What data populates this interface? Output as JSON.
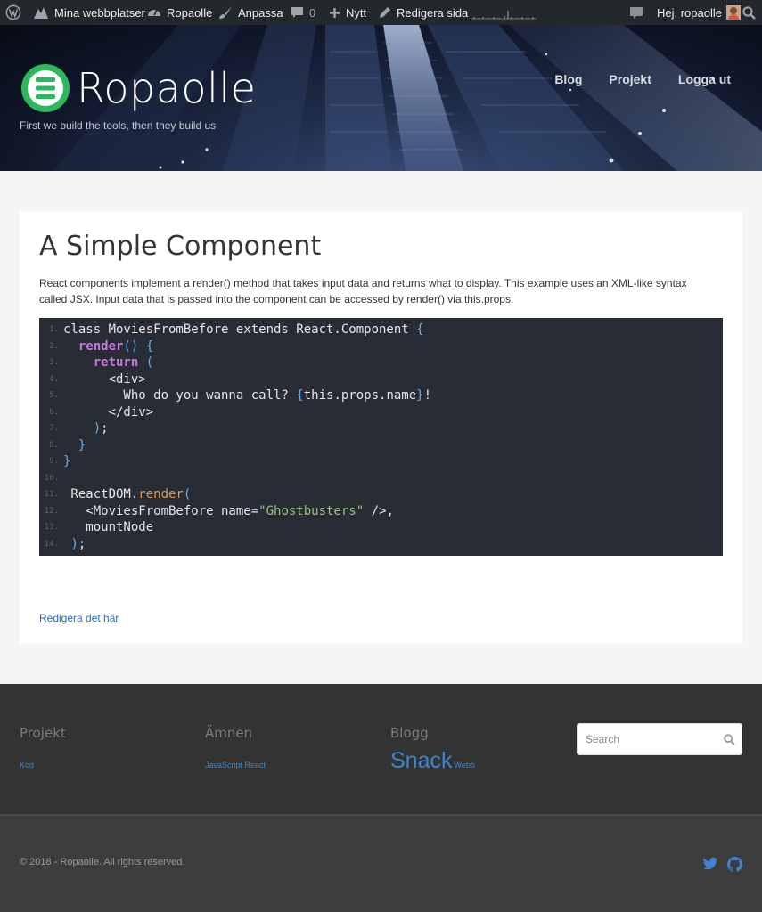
{
  "adminbar": {
    "sites_label": "Mina webbplatser",
    "site_label": "Ropaolle",
    "customize_label": "Anpassa",
    "comments_count": "0",
    "new_label": "Nytt",
    "edit_page_label": "Redigera sida",
    "greeting": "Hej, ropaolle"
  },
  "header": {
    "site_title": "Ropaolle",
    "tagline": "First we build the tools, then they build us",
    "nav": [
      "Blog",
      "Projekt",
      "Logga ut"
    ]
  },
  "post": {
    "title": "A Simple Component",
    "intro": "React components implement a render() method that takes input data and returns what to display. This example uses an XML-like syntax called JSX. Input data that is passed into the component can be accessed by render() via this.props.",
    "code_lines": [
      "class MoviesFromBefore extends React.Component {",
      "  render() {",
      "    return (",
      "      <div>",
      "        Who do you wanna call? {this.props.name}!",
      "      </div>",
      "    );",
      "  }",
      "}",
      "",
      " ReactDOM.render(",
      "   <MoviesFromBefore name=\"Ghostbusters\" />,",
      "   mountNode",
      " );"
    ],
    "edit_link": "Redigera det här"
  },
  "footer": {
    "widgets": [
      {
        "title": "Projekt",
        "links": [
          "Kod"
        ]
      },
      {
        "title": "Ämnen",
        "links": [
          "JavaScript React"
        ]
      },
      {
        "title": "Blogg",
        "tags": [
          "Snack",
          "Webb"
        ]
      }
    ],
    "search_placeholder": "Search",
    "copyright": "© 2018 - Ropaolle. All rights reserved."
  },
  "colors": {
    "admin_bar": "#23282d",
    "accent": "#3d86cf",
    "logo_green": "#2eb85c",
    "code_bg": "#282c34"
  },
  "icons": [
    "wordpress-icon",
    "my-sites-icon",
    "dashboard-icon",
    "brush-icon",
    "comment-icon",
    "plus-icon",
    "pencil-icon",
    "avatar",
    "search-icon",
    "twitter-icon",
    "github-icon"
  ]
}
